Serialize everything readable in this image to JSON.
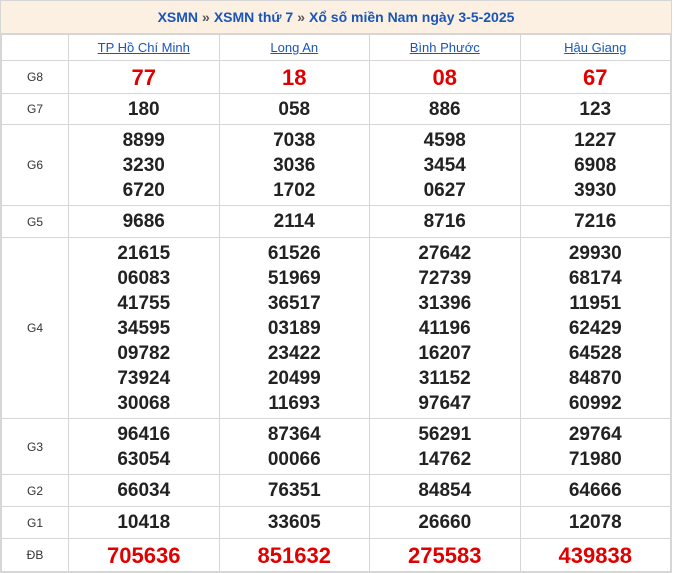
{
  "breadcrumb": {
    "link1": "XSMN",
    "sep1": "»",
    "link2": "XSMN thứ 7",
    "sep2": "»",
    "current": "Xổ số miền Nam ngày 3-5-2025"
  },
  "provinces": [
    "TP Hồ Chí Minh",
    "Long An",
    "Bình Phước",
    "Hậu Giang"
  ],
  "prizes": {
    "g8": {
      "label": "G8",
      "values": [
        [
          "77"
        ],
        [
          "18"
        ],
        [
          "08"
        ],
        [
          "67"
        ]
      ]
    },
    "g7": {
      "label": "G7",
      "values": [
        [
          "180"
        ],
        [
          "058"
        ],
        [
          "886"
        ],
        [
          "123"
        ]
      ]
    },
    "g6": {
      "label": "G6",
      "values": [
        [
          "8899",
          "3230",
          "6720"
        ],
        [
          "7038",
          "3036",
          "1702"
        ],
        [
          "4598",
          "3454",
          "0627"
        ],
        [
          "1227",
          "6908",
          "3930"
        ]
      ]
    },
    "g5": {
      "label": "G5",
      "values": [
        [
          "9686"
        ],
        [
          "2114"
        ],
        [
          "8716"
        ],
        [
          "7216"
        ]
      ]
    },
    "g4": {
      "label": "G4",
      "values": [
        [
          "21615",
          "06083",
          "41755",
          "34595",
          "09782",
          "73924",
          "30068"
        ],
        [
          "61526",
          "51969",
          "36517",
          "03189",
          "23422",
          "20499",
          "11693"
        ],
        [
          "27642",
          "72739",
          "31396",
          "41196",
          "16207",
          "31152",
          "97647"
        ],
        [
          "29930",
          "68174",
          "11951",
          "62429",
          "64528",
          "84870",
          "60992"
        ]
      ]
    },
    "g3": {
      "label": "G3",
      "values": [
        [
          "96416",
          "63054"
        ],
        [
          "87364",
          "00066"
        ],
        [
          "56291",
          "14762"
        ],
        [
          "29764",
          "71980"
        ]
      ]
    },
    "g2": {
      "label": "G2",
      "values": [
        [
          "66034"
        ],
        [
          "76351"
        ],
        [
          "84854"
        ],
        [
          "64666"
        ]
      ]
    },
    "g1": {
      "label": "G1",
      "values": [
        [
          "10418"
        ],
        [
          "33605"
        ],
        [
          "26660"
        ],
        [
          "12078"
        ]
      ]
    },
    "gdb": {
      "label": "ĐB",
      "values": [
        [
          "705636"
        ],
        [
          "851632"
        ],
        [
          "275583"
        ],
        [
          "439838"
        ]
      ]
    }
  },
  "colors": {
    "link": "#1a56b8",
    "highlight": "#e00000",
    "header_bg": "#fbf0e2"
  }
}
